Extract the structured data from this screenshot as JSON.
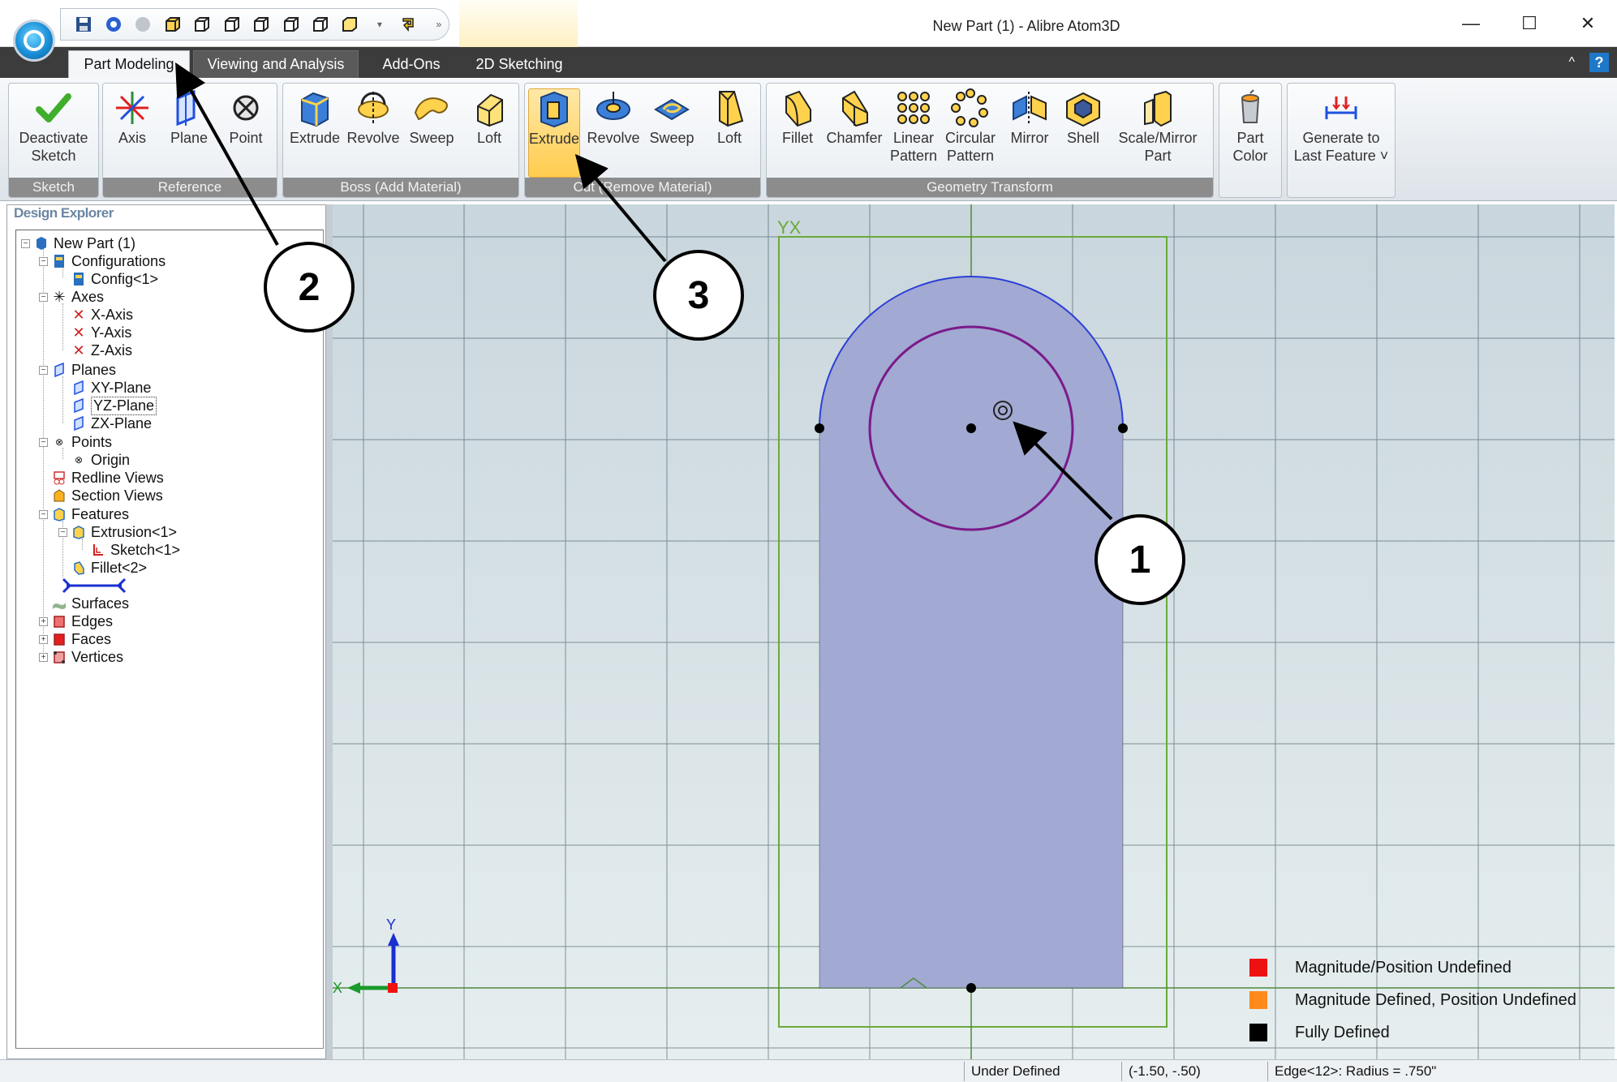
{
  "window": {
    "title": "New Part (1) - Alibre Atom3D",
    "minimize": "—",
    "maximize": "☐",
    "close": "✕"
  },
  "tabs": [
    {
      "label": "Part Modeling"
    },
    {
      "label": "Viewing and Analysis"
    },
    {
      "label": "Add-Ons"
    },
    {
      "label": "2D Sketching"
    }
  ],
  "ribbon": {
    "groups": {
      "sketch": "Sketch",
      "reference": "Reference",
      "boss": "Boss (Add Material)",
      "cut": "Cut (Remove Material)",
      "geometry": "Geometry Transform"
    },
    "buttons": {
      "deactivate_sketch": "Deactivate\nSketch",
      "axis": "Axis",
      "plane": "Plane",
      "point": "Point",
      "boss_extrude": "Extrude",
      "boss_revolve": "Revolve",
      "boss_sweep": "Sweep",
      "boss_loft": "Loft",
      "cut_extrude": "Extrude",
      "cut_revolve": "Revolve",
      "cut_sweep": "Sweep",
      "cut_loft": "Loft",
      "fillet": "Fillet",
      "chamfer": "Chamfer",
      "linear_pattern": "Linear\nPattern",
      "circular_pattern": "Circular\nPattern",
      "mirror": "Mirror",
      "shell": "Shell",
      "scale_mirror_part": "Scale/Mirror\nPart",
      "part_color": "Part\nColor",
      "generate_last_feature": "Generate to\nLast Feature ˅"
    }
  },
  "explorer": {
    "title": "Design Explorer",
    "tree": {
      "root": "New Part (1)",
      "configurations": "Configurations",
      "config1": "Config<1>",
      "axes": "Axes",
      "x_axis": "X-Axis",
      "y_axis": "Y-Axis",
      "z_axis": "Z-Axis",
      "planes": "Planes",
      "xy_plane": "XY-Plane",
      "yz_plane": "YZ-Plane",
      "zx_plane": "ZX-Plane",
      "points": "Points",
      "origin": "Origin",
      "redline_views": "Redline Views",
      "section_views": "Section Views",
      "features": "Features",
      "extrusion1": "Extrusion<1>",
      "sketch1": "Sketch<1>",
      "fillet2": "Fillet<2>",
      "surfaces": "Surfaces",
      "edges": "Edges",
      "faces": "Faces",
      "vertices": "Vertices"
    }
  },
  "viewport": {
    "plane_label": "YX",
    "axis_y_label": "Y",
    "axis_x_label": "X"
  },
  "legend": [
    {
      "label": "Magnitude/Position Undefined",
      "color": "#ee1111"
    },
    {
      "label": "Magnitude Defined, Position Undefined",
      "color": "#ff8a1c"
    },
    {
      "label": "Fully Defined",
      "color": "#000000"
    }
  ],
  "status": {
    "state": "Under Defined",
    "coords": "(-1.50, -.50)",
    "selection": "Edge<12>: Radius = .750\""
  },
  "callouts": [
    "1",
    "2",
    "3"
  ],
  "colors": {
    "sketch_fill": "#a2a9d2",
    "arc": "#2b3fd6",
    "circle": "#7a1a8a",
    "grid": "#3d5560",
    "plane_border": "#6aaa3a",
    "active_button": "#ffcc4d"
  }
}
